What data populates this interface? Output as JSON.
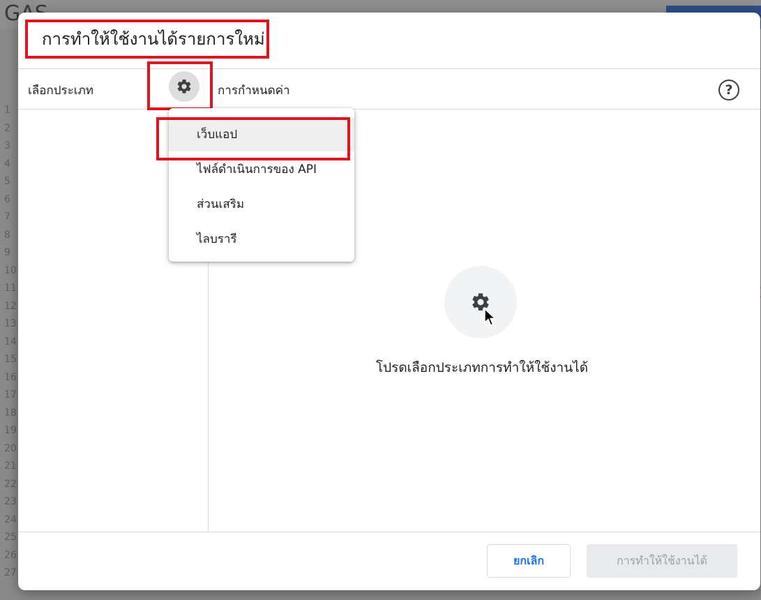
{
  "background": {
    "logo": "GAS",
    "line_numbers": [
      "1",
      "2",
      "3",
      "4",
      "5",
      "6",
      "7",
      "8",
      "9",
      "10",
      "11",
      "12",
      "13",
      "14",
      "15",
      "16",
      "17",
      "18",
      "19",
      "20",
      "21",
      "22",
      "23",
      "24",
      "25",
      "26",
      "27"
    ]
  },
  "dialog": {
    "title": "การทำให้ใช้งานได้รายการใหม่",
    "select_type_label": "เลือกประเภท",
    "config_label": "การกำหนดค่า",
    "help_icon": "help-circle-icon",
    "gear_icon": "gear-icon"
  },
  "type_menu": {
    "items": [
      {
        "label": "เว็บแอป",
        "selected": true
      },
      {
        "label": "ไฟล์ดำเนินการของ API",
        "selected": false
      },
      {
        "label": "ส่วนเสริม",
        "selected": false
      },
      {
        "label": "ไลบรารี",
        "selected": false
      }
    ]
  },
  "empty_state": {
    "message": "โปรดเลือกประเภทการทำให้ใช้งานได้"
  },
  "footer": {
    "cancel_label": "ยกเลิก",
    "deploy_label": "การทำให้ใช้งานได้"
  },
  "colors": {
    "highlight": "#e0141e",
    "accent": "#1a73e8",
    "disabled_bg": "#e8eaed"
  }
}
